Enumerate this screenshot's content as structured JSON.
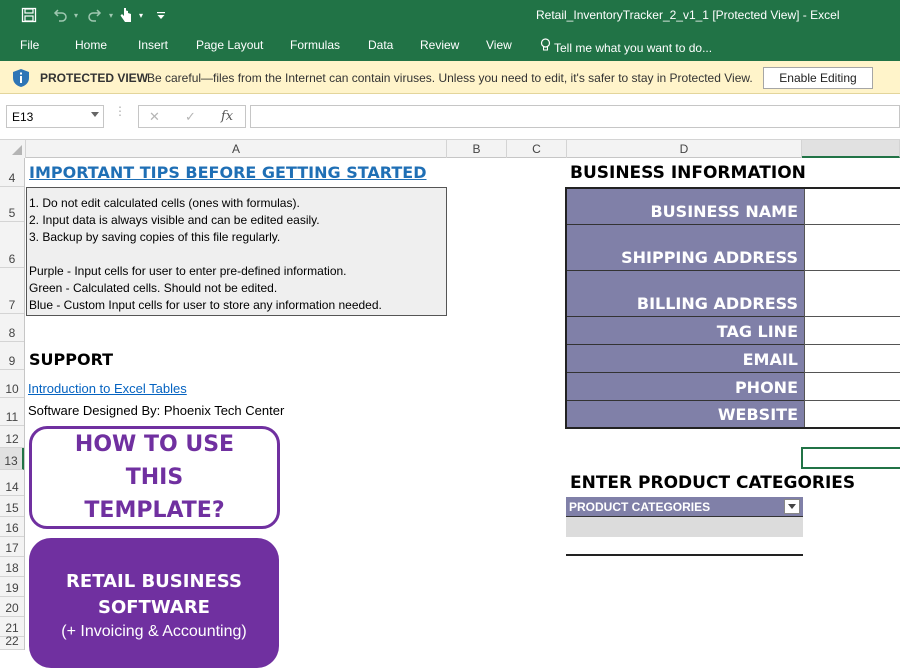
{
  "window": {
    "title": "Retail_InventoryTracker_2_v1_1  [Protected View] - Excel",
    "theme_color": "#217346"
  },
  "quick_access": {
    "icons": [
      "save-icon",
      "undo-icon",
      "redo-icon",
      "touch-mode-icon",
      "customize-qat-icon"
    ]
  },
  "ribbon": {
    "file": "File",
    "tabs": [
      "Home",
      "Insert",
      "Page Layout",
      "Formulas",
      "Data",
      "Review",
      "View"
    ],
    "tell_me": "Tell me what you want to do..."
  },
  "protected_view": {
    "label": "PROTECTED VIEW",
    "message": "Be careful—files from the Internet can contain viruses. Unless you need to edit, it's safer to stay in Protected View.",
    "button": "Enable Editing",
    "bar_color": "#fff4ca"
  },
  "formula_bar": {
    "name_box": "E13",
    "cancel": "✕",
    "enter": "✓",
    "fx": "fx",
    "formula": ""
  },
  "columns": [
    "A",
    "B",
    "C",
    "D"
  ],
  "rows": [
    "4",
    "5",
    "6",
    "7",
    "8",
    "9",
    "10",
    "11",
    "12",
    "13",
    "14",
    "15",
    "16",
    "17",
    "18",
    "19",
    "20",
    "21",
    "22"
  ],
  "sheet": {
    "tips_title": "IMPORTANT TIPS BEFORE GETTING STARTED",
    "tips": [
      "1. Do not edit calculated cells (ones with formulas).",
      "2. Input data is always visible and can be edited easily.",
      "3. Backup by saving copies of this file regularly.",
      "Purple - Input cells for user to enter pre-defined information.",
      "Green - Calculated cells. Should not be edited.",
      "Blue - Custom Input cells for user to store any information needed."
    ],
    "support_title": "SUPPORT",
    "support_link": "Introduction to Excel Tables",
    "designed_by": "Software Designed By: Phoenix Tech Center",
    "how_to_use": "HOW TO USE THIS TEMPLATE?",
    "retail_title": "RETAIL BUSINESS SOFTWARE",
    "retail_sub": "(+ Invoicing & Accounting)",
    "business_info_title": "BUSINESS INFORMATION",
    "business_fields": [
      "BUSINESS NAME",
      "SHIPPING ADDRESS",
      "BILLING ADDRESS",
      "TAG LINE",
      "EMAIL",
      "PHONE",
      "WEBSITE"
    ],
    "categories_title": "ENTER PRODUCT CATEGORIES",
    "categories_header": "PRODUCT CATEGORIES"
  },
  "colors": {
    "purple": "#7030a0",
    "label_fill": "#8080a8",
    "link": "#0563c1",
    "tips_title": "#1f6fb5"
  }
}
